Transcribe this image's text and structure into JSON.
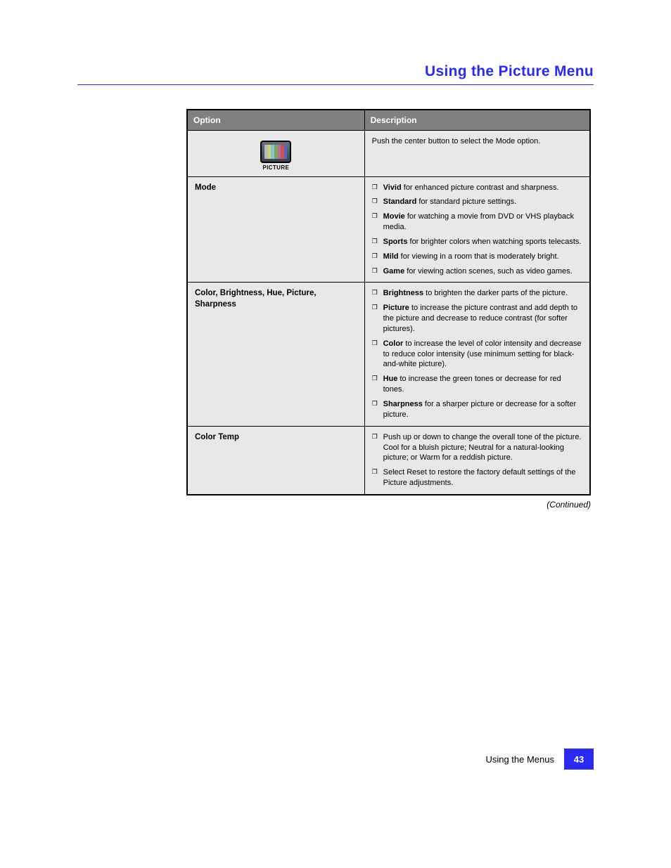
{
  "header": "Using the Picture Menu",
  "table": {
    "headers": [
      "Option",
      "Description"
    ],
    "rows": [
      {
        "option": "_icon_",
        "icon_label": "PICTURE",
        "desc": "Push the center button to select the Mode option."
      },
      {
        "option": "Mode",
        "items": [
          {
            "label": "Vivid",
            "text": " for enhanced picture contrast and sharpness."
          },
          {
            "label": "Standard",
            "text": " for standard picture settings."
          },
          {
            "label": "Movie",
            "text": " for watching a movie from DVD or VHS playback media."
          },
          {
            "label": "Sports",
            "text": " for brighter colors when watching sports telecasts."
          },
          {
            "label": "Mild",
            "text": " for viewing in a room that is moderately bright."
          },
          {
            "label": "Game",
            "text": " for viewing action scenes, such as video games."
          }
        ]
      },
      {
        "option": "Color, Brightness, Hue, Picture, Sharpness",
        "items": [
          {
            "label": "Brightness",
            "text": " to brighten the darker parts of the picture."
          },
          {
            "label": "Picture",
            "text": " to increase the picture contrast and add depth to the picture and decrease to reduce contrast (for softer pictures)."
          },
          {
            "label": "Color",
            "text": " to increase the level of color intensity and decrease to reduce color intensity (use minimum setting for black-and-white picture)."
          },
          {
            "label": "Hue",
            "text": " to increase the green tones or decrease for red tones."
          },
          {
            "label": "Sharpness",
            "text": " for a sharper picture or decrease for a softer picture."
          }
        ]
      },
      {
        "option": "Color Temp",
        "items": [
          {
            "label": "",
            "text": "Push up or down to change the overall tone of the picture. Cool for a bluish picture; Neutral for a natural-looking picture; or Warm for a reddish picture."
          },
          {
            "label": "",
            "text": "Select Reset to restore the factory default settings of the Picture adjustments."
          }
        ]
      }
    ]
  },
  "continued": "(Continued)",
  "footer": {
    "label": "Using the Menus",
    "page": "43"
  }
}
